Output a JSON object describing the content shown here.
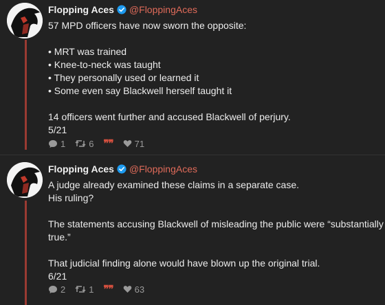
{
  "tweets": [
    {
      "name": "Flopping Aces",
      "handle": "@FloppingAces",
      "lines": [
        "57 MPD officers have now sworn the opposite:",
        "",
        "• MRT was trained",
        "• Knee-to-neck was taught",
        "• They personally used or learned it",
        "• Some even say Blackwell herself taught it",
        "",
        "14 officers went further and accused Blackwell of perjury.",
        "5/21"
      ],
      "replies": "1",
      "retweets": "6",
      "likes": "71"
    },
    {
      "name": "Flopping Aces",
      "handle": "@FloppingAces",
      "lines": [
        "A judge already examined these claims in a separate case.",
        "His ruling?",
        "",
        "The statements accusing Blackwell of misleading the public were “substantially",
        "true.”",
        "",
        "That judicial finding alone would have blown up the original trial.",
        "6/21"
      ],
      "replies": "2",
      "retweets": "1",
      "likes": "63"
    }
  ],
  "colors": {
    "background": "#222222",
    "accent": "#e06b5a",
    "thread_line": "#9a3a32",
    "verified": "#1d9bf0"
  }
}
